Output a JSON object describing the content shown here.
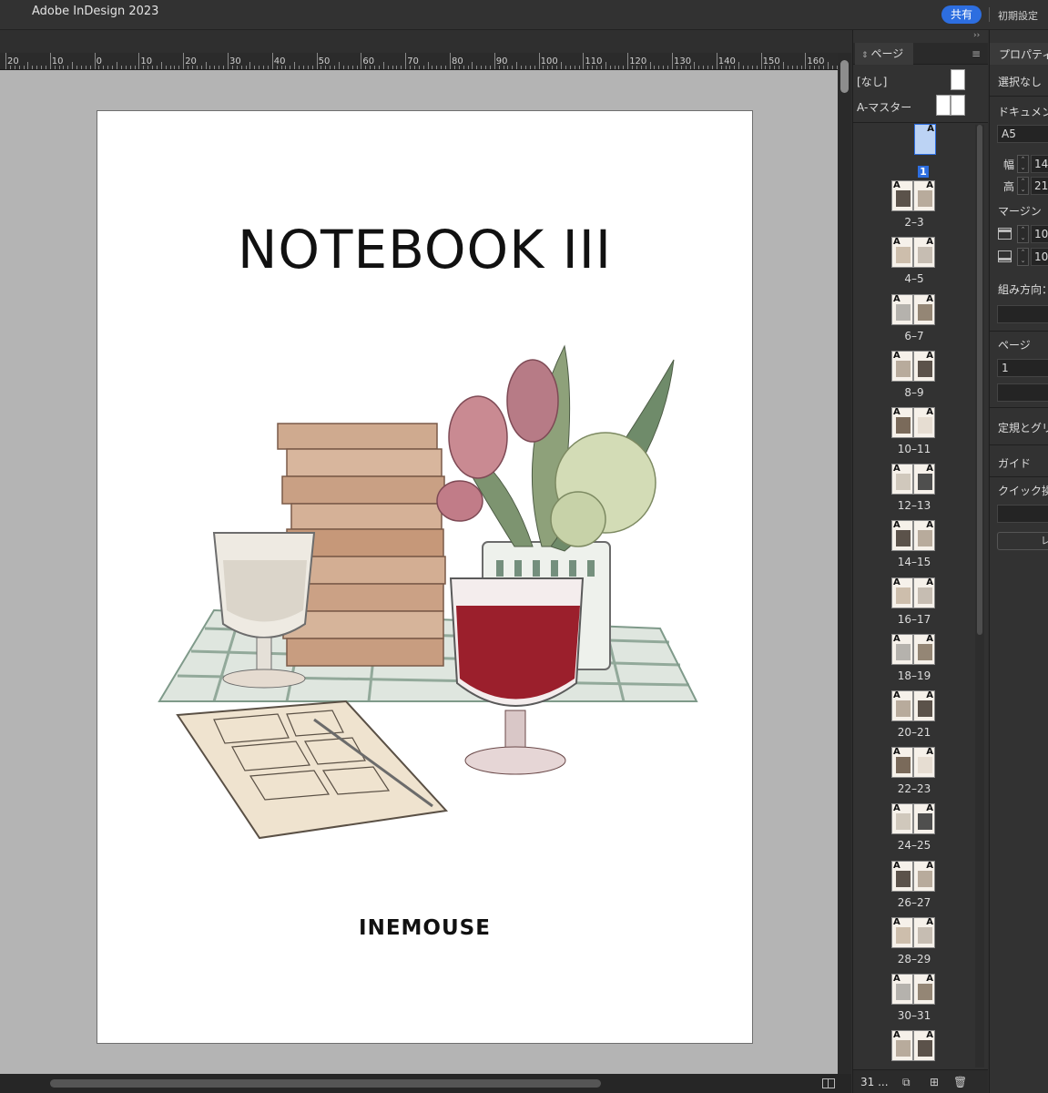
{
  "app": {
    "title": "Adobe InDesign 2023",
    "share_label": "共有",
    "prefs_label": "初期設定"
  },
  "ruler": {
    "labels": [
      "20",
      "10",
      "0",
      "10",
      "20",
      "30",
      "40",
      "50",
      "60",
      "70",
      "80",
      "90",
      "100",
      "110",
      "120",
      "130",
      "140",
      "150",
      "160"
    ]
  },
  "document": {
    "title": "NOTEBOOK III",
    "author": "INEMOUSE"
  },
  "pages_panel": {
    "tab_label": "ページ",
    "masters": [
      {
        "label": "[なし]"
      },
      {
        "label": "A-マスター"
      }
    ],
    "spreads": [
      {
        "label": "1",
        "selected": true
      },
      {
        "label": "2–3"
      },
      {
        "label": "4–5"
      },
      {
        "label": "6–7"
      },
      {
        "label": "8–9"
      },
      {
        "label": "10–11"
      },
      {
        "label": "12–13"
      },
      {
        "label": "14–15"
      },
      {
        "label": "16–17"
      },
      {
        "label": "18–19"
      },
      {
        "label": "20–21"
      },
      {
        "label": "22–23"
      },
      {
        "label": "24–25"
      },
      {
        "label": "26–27"
      },
      {
        "label": "28–29"
      },
      {
        "label": "30–31"
      },
      {
        "label": ""
      }
    ],
    "master_letter": "A",
    "page_count": "31 ..."
  },
  "properties": {
    "tab_label": "プロパティ",
    "selection": "選択なし",
    "document_section": "ドキュメン",
    "page_size": "A5",
    "width_label": "幅",
    "width_value": "14",
    "height_label": "高",
    "height_value": "21",
    "margin_label": "マージン",
    "margin_top": "10",
    "margin_bottom": "10",
    "direction_label": "組み方向：",
    "page_label": "ページ",
    "page_value": "1",
    "rulers_grids_label": "定規とグリ",
    "guides_label": "ガイド",
    "quick_actions_label": "クイック操",
    "layout_btn": "レ"
  },
  "colors": {
    "accent": "#2d6ee0",
    "pasteboard": "#b4b4b4",
    "ui_dark": "#323232"
  }
}
